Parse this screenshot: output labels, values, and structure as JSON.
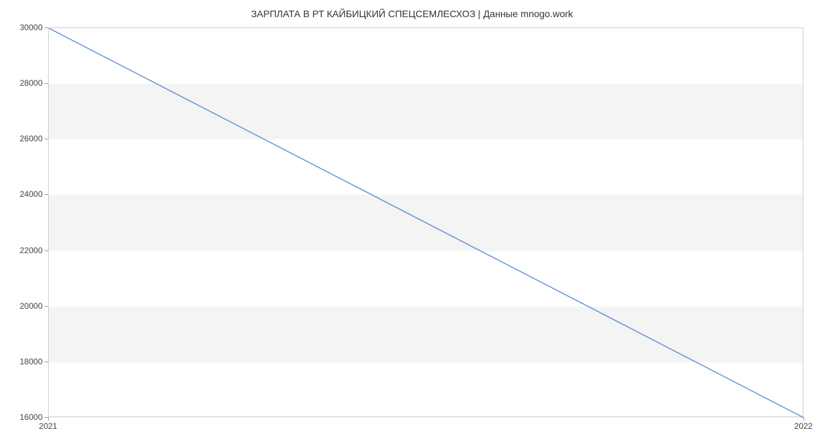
{
  "chart_data": {
    "type": "line",
    "title": "ЗАРПЛАТА В РТ КАЙБИЦКИЙ СПЕЦСЕМЛЕСХОЗ | Данные mnogo.work",
    "x": [
      "2021",
      "2022"
    ],
    "values": [
      30000,
      16000
    ],
    "xlabel": "",
    "ylabel": "",
    "ylim": [
      16000,
      30000
    ],
    "y_ticks": [
      16000,
      18000,
      20000,
      22000,
      24000,
      26000,
      28000,
      30000
    ],
    "x_ticks": [
      "2021",
      "2022"
    ]
  }
}
